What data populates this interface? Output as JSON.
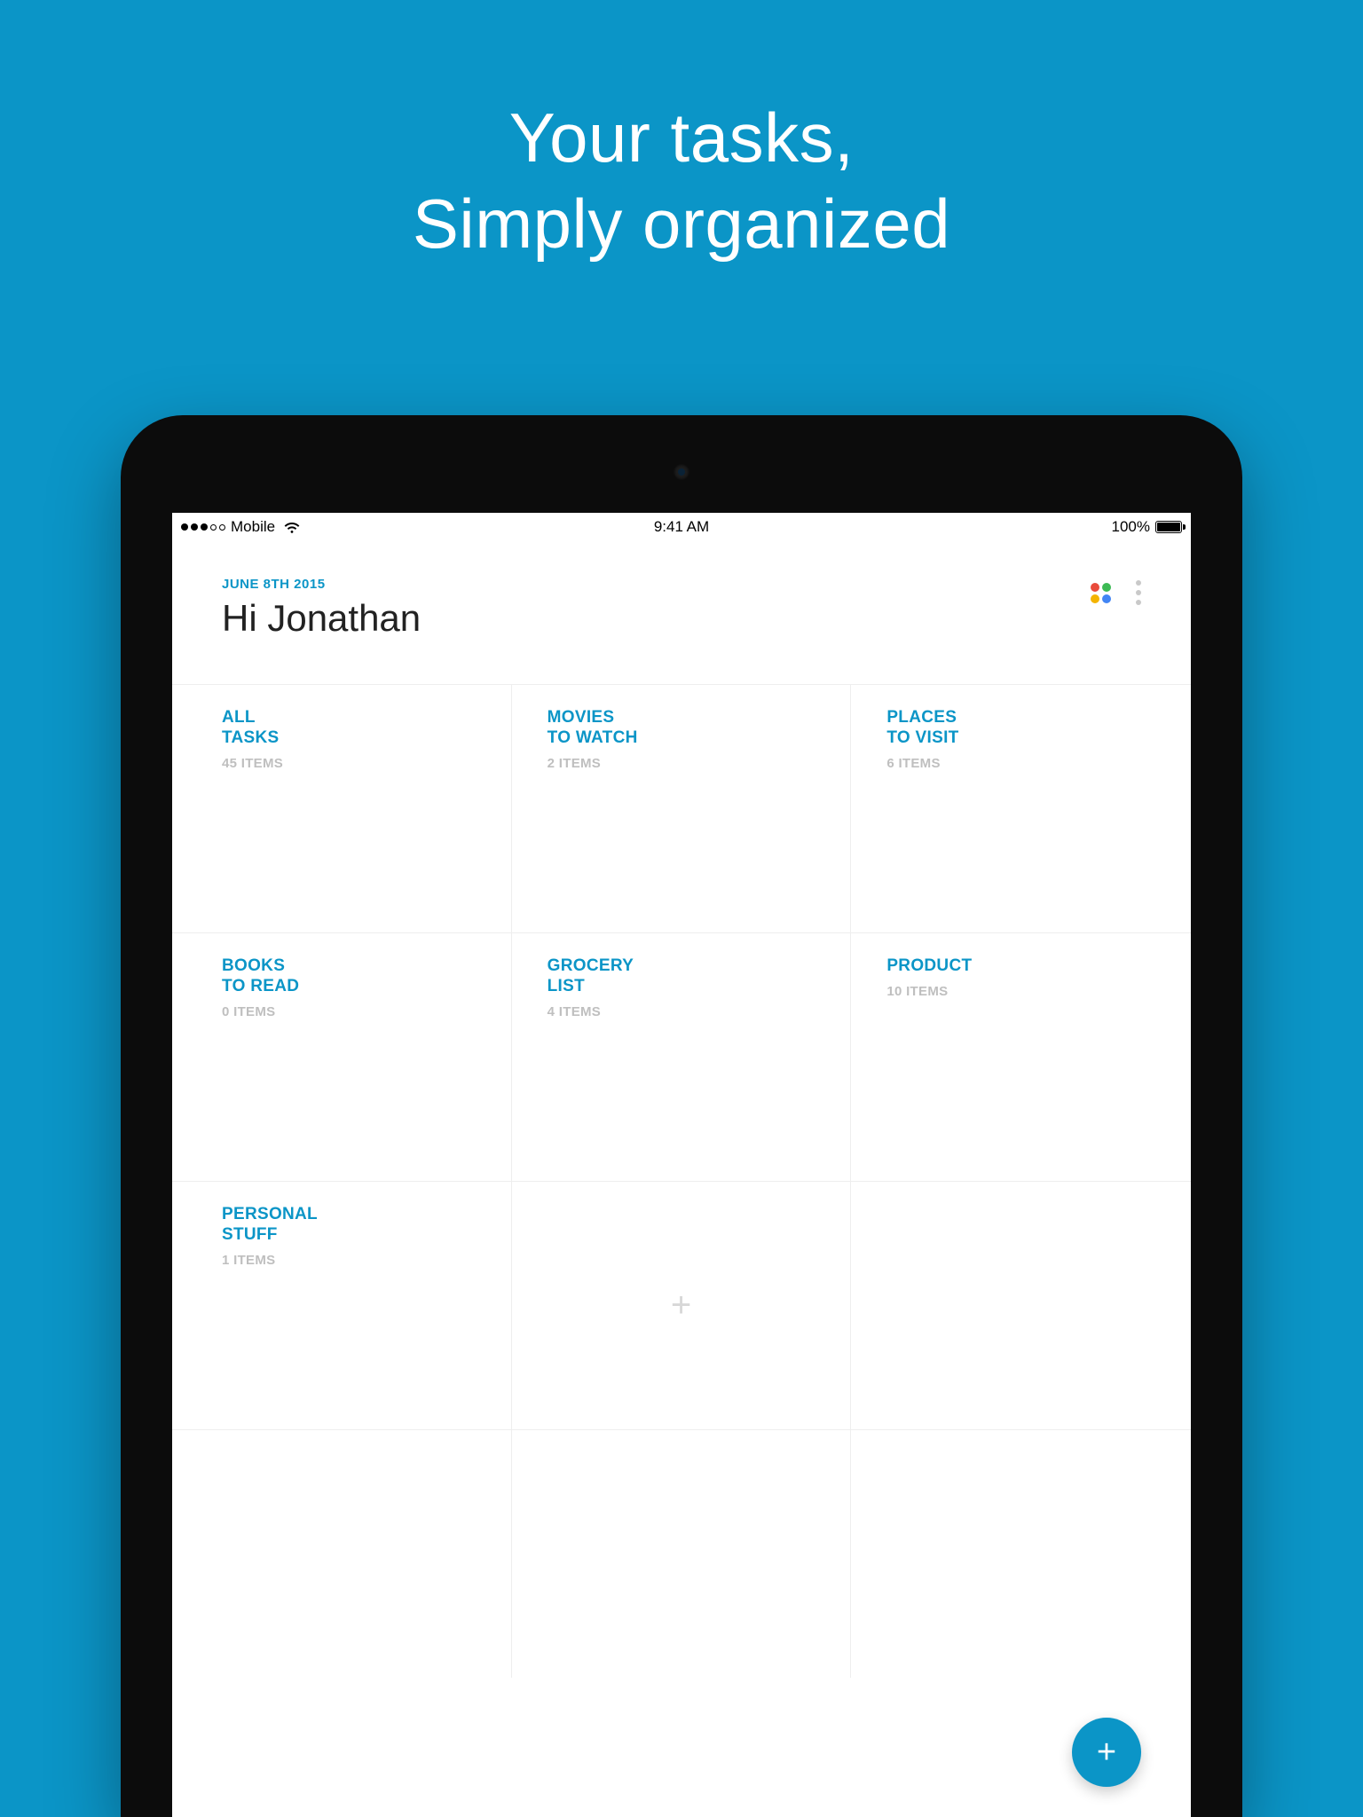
{
  "hero": {
    "line1": "Your tasks,",
    "line2_strong": "Simply",
    "line2_rest": " organized"
  },
  "statusbar": {
    "carrier": "Mobile",
    "time": "9:41 AM",
    "battery": "100%"
  },
  "header": {
    "date": "JUNE 8TH 2015",
    "greeting": "Hi Jonathan"
  },
  "lists": [
    {
      "title_l1": "ALL",
      "title_l2": "TASKS",
      "count": "45 ITEMS"
    },
    {
      "title_l1": "MOVIES",
      "title_l2": "TO WATCH",
      "count": "2 ITEMS"
    },
    {
      "title_l1": "PLACES",
      "title_l2": "TO VISIT",
      "count": "6 ITEMS"
    },
    {
      "title_l1": "BOOKS",
      "title_l2": "TO READ",
      "count": "0 ITEMS"
    },
    {
      "title_l1": "GROCERY",
      "title_l2": "LIST",
      "count": "4 ITEMS"
    },
    {
      "title_l1": "PRODUCT",
      "title_l2": "",
      "count": "10 ITEMS"
    },
    {
      "title_l1": "PERSONAL",
      "title_l2": "STUFF",
      "count": "1 ITEMS"
    }
  ],
  "fab": {
    "glyph": "+"
  },
  "add_cell": {
    "glyph": "+"
  }
}
